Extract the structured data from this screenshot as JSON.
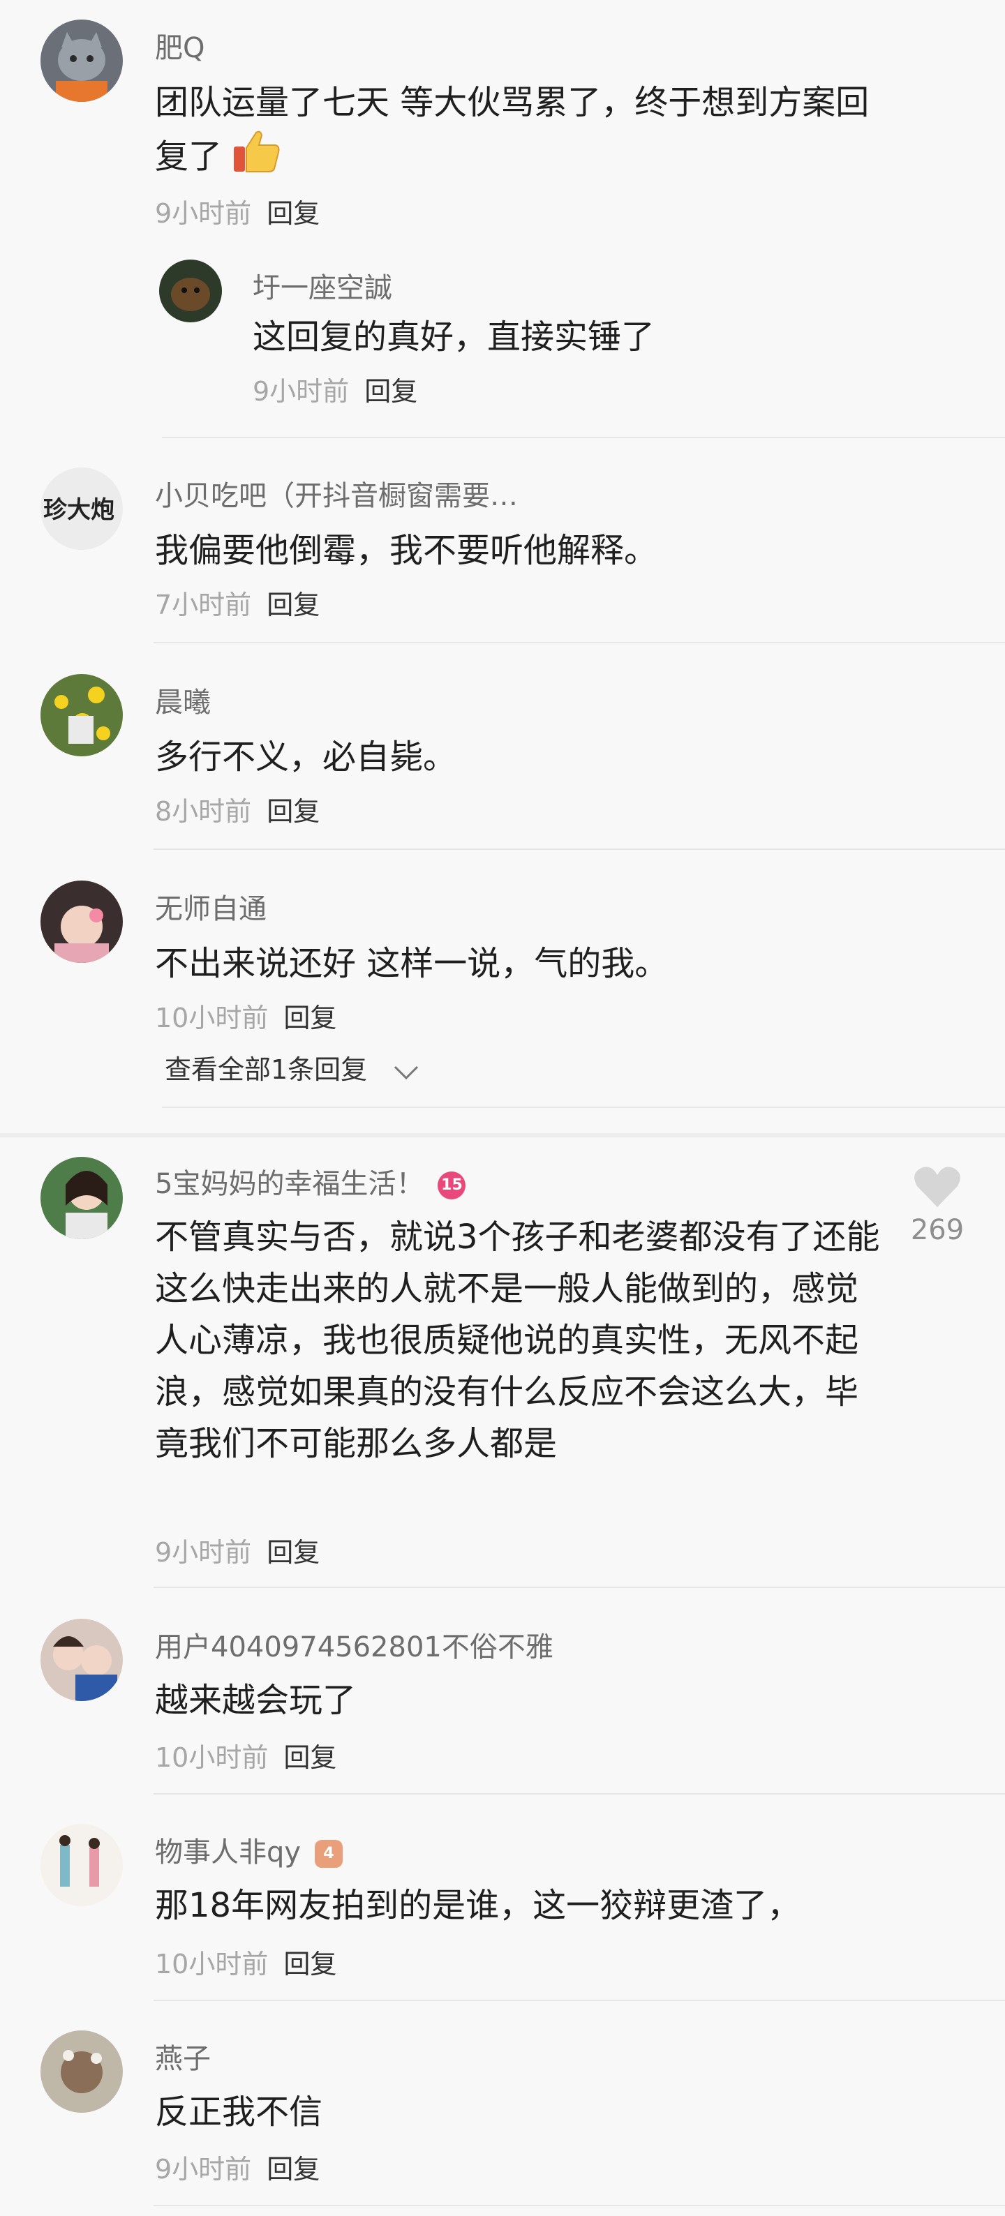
{
  "comments_top": [
    {
      "user": "肥Q",
      "text": "团队运量了七天 等大伙骂累了，终于想到方案回复了",
      "time": "9小时前",
      "reply": "回复",
      "sub": {
        "user": "圩一座空誠",
        "text": "这回复的真好，直接实锤了",
        "time": "9小时前",
        "reply": "回复"
      }
    },
    {
      "user": "小贝吃吧（开抖音橱窗需要…",
      "text": "我偏要他倒霉，我不要听他解释。",
      "time": "7小时前",
      "reply": "回复"
    },
    {
      "user": "晨曦",
      "text": "多行不义，必自毙。",
      "time": "8小时前",
      "reply": "回复"
    },
    {
      "user": "无师自通",
      "text": "不出来说还好 这样一说，气的我。",
      "time": "10小时前",
      "reply": "回复",
      "expand": "查看全部1条回复"
    }
  ],
  "comments_bottom": [
    {
      "user": "5宝妈妈的幸福生活！",
      "badge": "15",
      "text": "不管真实与否，就说3个孩子和老婆都没有了还能这么快走出来的人就不是一般人能做到的，感觉人心薄凉，我也很质疑他说的真实性，无风不起浪，感觉如果真的没有什么反应不会这么大，毕竟我们不可能那么多人都是",
      "time": "9小时前",
      "reply": "回复",
      "likes": "269"
    },
    {
      "user": "用户4040974562801不俗不雅",
      "text": "越来越会玩了",
      "time": "10小时前",
      "reply": "回复"
    },
    {
      "user": "物事人非qy",
      "badge": "4",
      "text": "那18年网友拍到的是谁，这一狡辩更渣了，",
      "time": "10小时前",
      "reply": "回复"
    },
    {
      "user": "燕子",
      "text": "反正我不信",
      "time": "9小时前",
      "reply": "回复"
    }
  ],
  "colors": {
    "badge_15": "#e8487a",
    "badge_4": "#e9a07a",
    "heart": "#d6d6d6"
  }
}
